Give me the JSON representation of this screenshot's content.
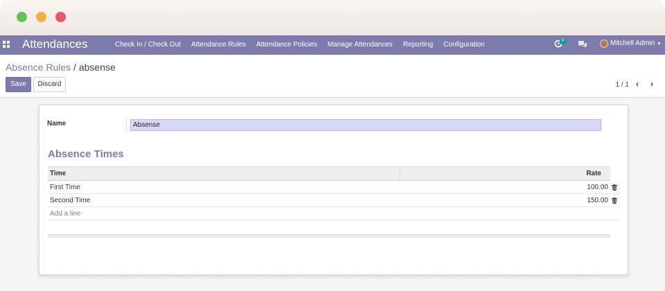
{
  "navbar": {
    "app_title": "Attendances",
    "menu": [
      "Check In / Check Out",
      "Attendance Rules",
      "Attendance Policies",
      "Manage Attendances",
      "Reporting",
      "Configuration"
    ],
    "activity_count": "9",
    "user_name": "Mitchell Admin"
  },
  "breadcrumb": {
    "parent": "Absence Rules",
    "separator": " / ",
    "current": "absense"
  },
  "toolbar": {
    "save_label": "Save",
    "discard_label": "Discard"
  },
  "pager": {
    "text": "1 / 1"
  },
  "form": {
    "name_label": "Name",
    "name_value": "Absense",
    "section_title": "Absence Times",
    "table": {
      "columns": [
        "Time",
        "Rate"
      ],
      "rows": [
        {
          "time": "First Time",
          "rate": "100.00"
        },
        {
          "time": "Second Time",
          "rate": "150.00"
        }
      ],
      "add_line": "Add a line"
    }
  },
  "colors": {
    "brand": "#7c7bad",
    "badge": "#00a09d"
  }
}
